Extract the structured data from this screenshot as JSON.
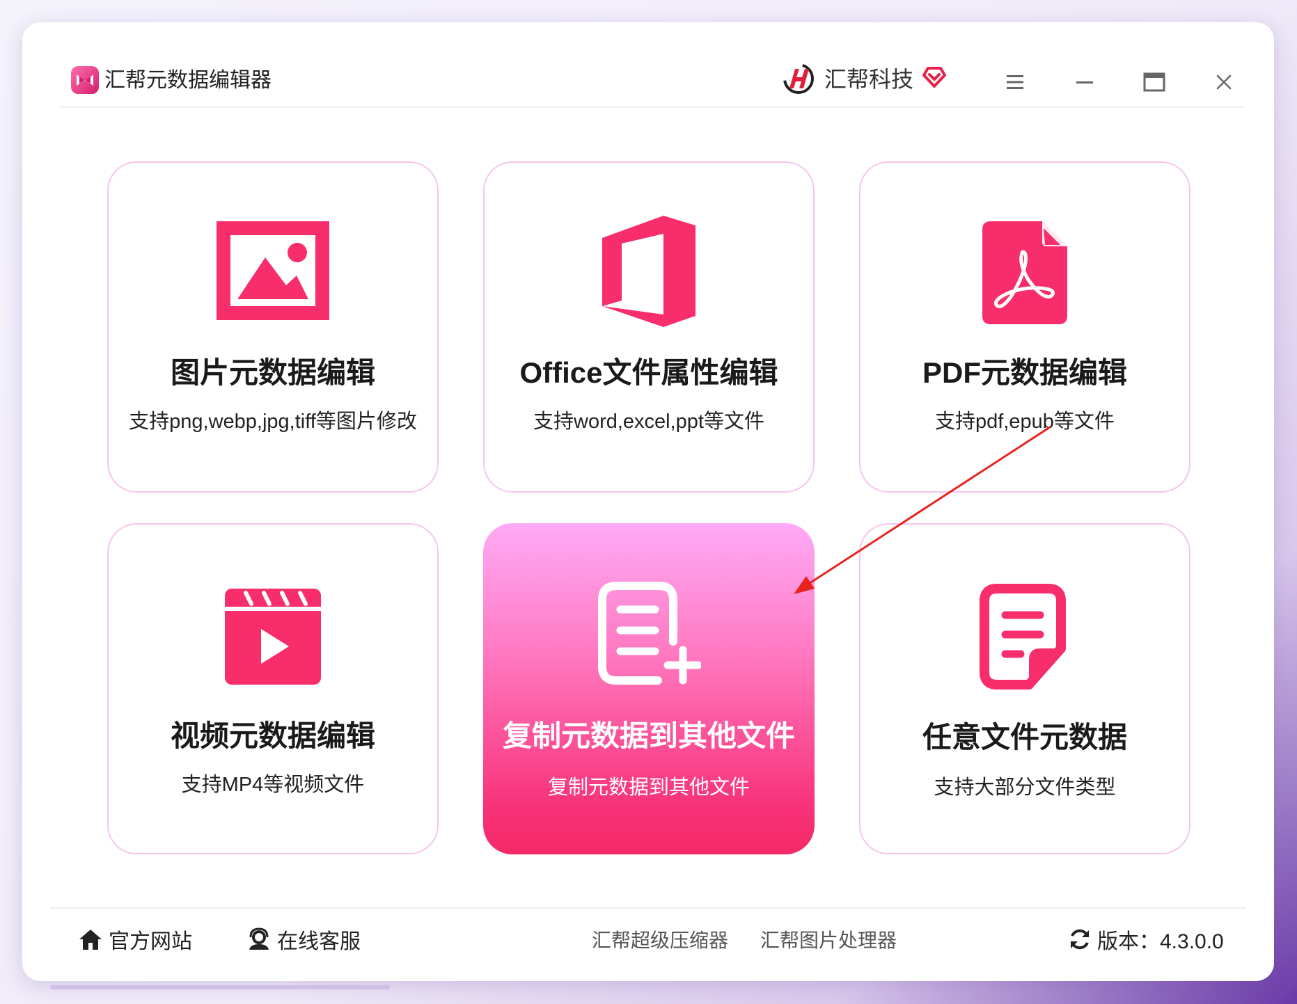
{
  "app": {
    "title": "汇帮元数据编辑器",
    "brand": "汇帮科技"
  },
  "window_controls": {
    "menu": "menu-icon",
    "minimize": "minimize-icon",
    "maximize": "maximize-icon",
    "close": "close-icon"
  },
  "cards": [
    {
      "title": "图片元数据编辑",
      "subtitle": "支持png,webp,jpg,tiff等图片修改",
      "icon": "image-icon"
    },
    {
      "title": "Office文件属性编辑",
      "subtitle": "支持word,excel,ppt等文件",
      "icon": "office-icon"
    },
    {
      "title": "PDF元数据编辑",
      "subtitle": "支持pdf,epub等文件",
      "icon": "pdf-icon"
    },
    {
      "title": "视频元数据编辑",
      "subtitle": "支持MP4等视频文件",
      "icon": "video-icon"
    },
    {
      "title": "复制元数据到其他文件",
      "subtitle": "复制元数据到其他文件",
      "icon": "copy-doc-icon",
      "active": true
    },
    {
      "title": "任意文件元数据",
      "subtitle": "支持大部分文件类型",
      "icon": "document-icon"
    }
  ],
  "footer": {
    "website": "官方网站",
    "support": "在线客服",
    "link1": "汇帮超级压缩器",
    "link2": "汇帮图片处理器",
    "version": "版本：4.3.0.0"
  },
  "colors": {
    "accent": "#f82d6c",
    "card_border": "#f3c6ee",
    "active_top": "#ffaaf6",
    "active_bottom": "#f32966",
    "annotation_arrow": "#e8231f"
  }
}
